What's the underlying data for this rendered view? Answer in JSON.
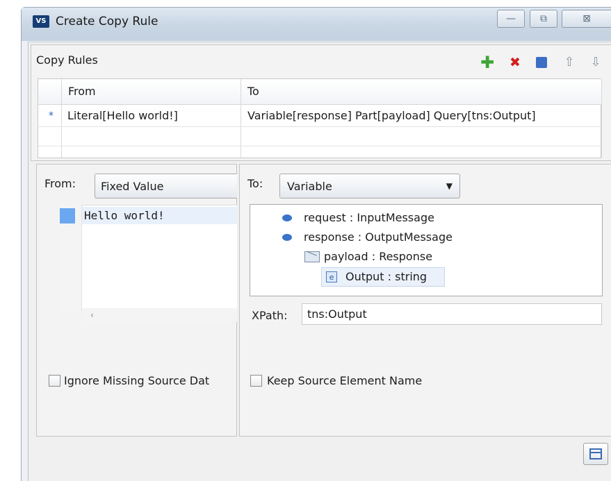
{
  "window": {
    "app_icon": "VS",
    "title": "Create Copy Rule",
    "minimize_glyph": "—",
    "maximize_glyph": "⧉",
    "close_glyph": "⊠"
  },
  "copy_rules": {
    "title": "Copy Rules",
    "toolbar": {
      "add_icon": "✚",
      "delete_icon": "✖",
      "move_up_icon": "⇧",
      "move_down_icon": "⇩"
    },
    "columns": [
      "From",
      "To"
    ],
    "rows": [
      {
        "marker": "*",
        "from": "Literal[Hello world!]",
        "to": "Variable[response] Part[payload] Query[tns:Output]"
      }
    ]
  },
  "from_panel": {
    "label": "From:",
    "type_value": "Fixed Value",
    "source_text": "Hello world!",
    "scroll_glyph": "‹",
    "ignore_missing_label": "Ignore Missing Source Dat"
  },
  "to_panel": {
    "label": "To:",
    "type_value": "Variable",
    "dropdown_glyph": "▼",
    "tree": [
      {
        "label": "request : InputMessage",
        "kind": "variable"
      },
      {
        "label": "response : OutputMessage",
        "kind": "variable"
      },
      {
        "label": "payload : Response",
        "kind": "part"
      },
      {
        "label": "Output : string",
        "kind": "element",
        "icon_text": "e"
      }
    ],
    "xpath_label": "XPath:",
    "xpath_value": "tns:Output",
    "keep_name_label": "Keep Source Element Name"
  },
  "colors": {
    "accent": "#3a74c9",
    "add": "#3ca535",
    "delete": "#d31f1f"
  }
}
